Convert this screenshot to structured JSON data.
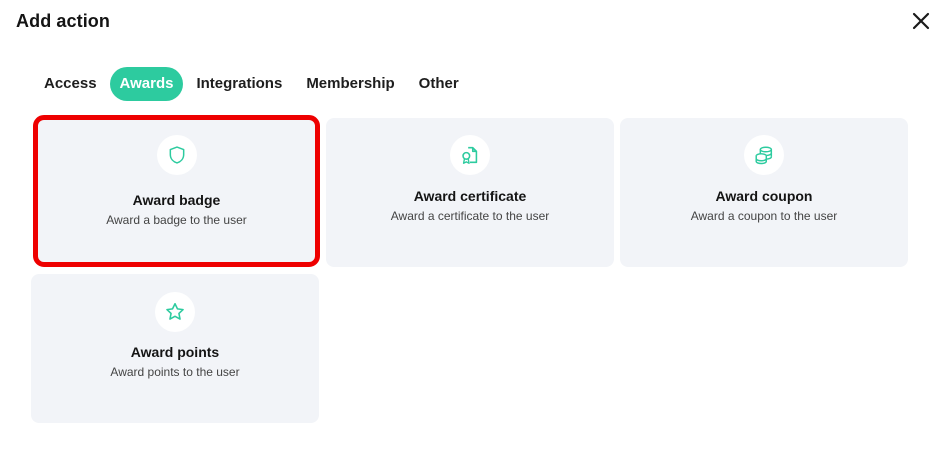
{
  "dialog": {
    "title": "Add action",
    "close_icon": "close-icon"
  },
  "tabs": [
    {
      "label": "Access",
      "active": false
    },
    {
      "label": "Awards",
      "active": true
    },
    {
      "label": "Integrations",
      "active": false
    },
    {
      "label": "Membership",
      "active": false
    },
    {
      "label": "Other",
      "active": false
    }
  ],
  "colors": {
    "accent": "#2dcb9f",
    "card_bg": "#f2f4f8",
    "selection_outline": "#ee0000"
  },
  "actions": [
    {
      "title": "Award badge",
      "description": "Award a badge to the user",
      "icon": "shield-icon",
      "selected": true
    },
    {
      "title": "Award certificate",
      "description": "Award a certificate to the user",
      "icon": "certificate-icon",
      "selected": false
    },
    {
      "title": "Award coupon",
      "description": "Award a coupon to the user",
      "icon": "coins-icon",
      "selected": false
    },
    {
      "title": "Award points",
      "description": "Award points to the user",
      "icon": "star-icon",
      "selected": false
    }
  ]
}
